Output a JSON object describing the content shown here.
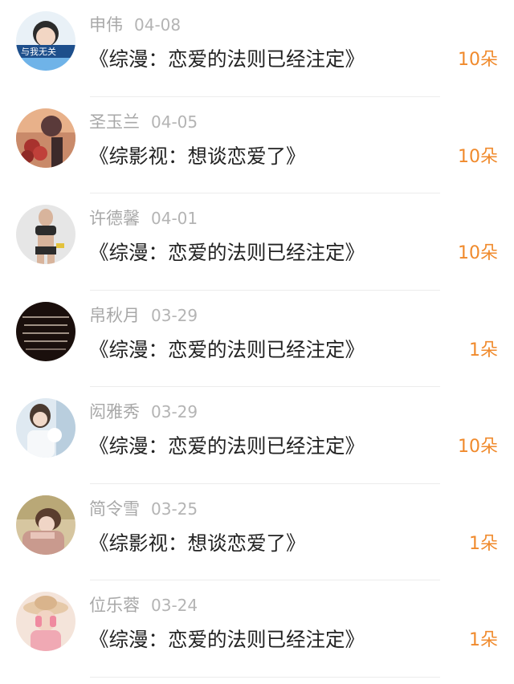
{
  "records": [
    {
      "name": "申伟",
      "date": "04-08",
      "title": "《综漫：恋爱的法则已经注定》",
      "gift": "10朵",
      "avatar_icon": "avatar-photo-boy-banner-icon",
      "avatar_colors": [
        "#6fb3e8",
        "#1d4f8c"
      ]
    },
    {
      "name": "圣玉兰",
      "date": "04-05",
      "title": "《综影视：想谈恋爱了》",
      "gift": "10朵",
      "avatar_icon": "avatar-photo-roses-icon",
      "avatar_colors": [
        "#e8b18a",
        "#a8322e"
      ]
    },
    {
      "name": "许德馨",
      "date": "04-01",
      "title": "《综漫：恋爱的法则已经注定》",
      "gift": "10朵",
      "avatar_icon": "avatar-photo-fitness-woman-icon",
      "avatar_colors": [
        "#d9d9d9",
        "#3b3b3b"
      ]
    },
    {
      "name": "帛秋月",
      "date": "03-29",
      "title": "《综漫：恋爱的法则已经注定》",
      "gift": "1朵",
      "avatar_icon": "avatar-dark-text-quote-icon",
      "avatar_colors": [
        "#1a0f0c",
        "#e8d8c8"
      ]
    },
    {
      "name": "闳雅秀",
      "date": "03-29",
      "title": "《综漫：恋爱的法则已经注定》",
      "gift": "10朵",
      "avatar_icon": "avatar-photo-girl-white-icon",
      "avatar_colors": [
        "#cfe0ee",
        "#e8eef4"
      ]
    },
    {
      "name": "简令雪",
      "date": "03-25",
      "title": "《综影视：想谈恋爱了》",
      "gift": "1朵",
      "avatar_icon": "avatar-photo-girl-scarf-icon",
      "avatar_colors": [
        "#cdbb94",
        "#c99a8e"
      ]
    },
    {
      "name": "位乐蓉",
      "date": "03-24",
      "title": "《综漫：恋爱的法则已经注定》",
      "gift": "1朵",
      "avatar_icon": "avatar-photo-girl-hat-icon",
      "avatar_colors": [
        "#f3c9b8",
        "#d9b49a"
      ]
    }
  ]
}
